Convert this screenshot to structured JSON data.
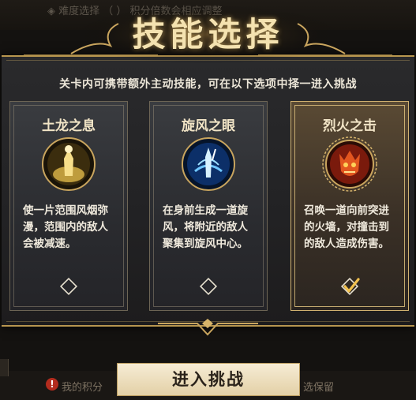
{
  "background": {
    "top_text": "◈ 难度选择 （  ） 积分倍数会相应调整",
    "bottom_left": "我的积分",
    "bottom_right": "选保留",
    "warn_glyph": "!"
  },
  "dialog": {
    "title": "技能选择",
    "subtitle": "关卡内可携带额外主动技能，可在以下选项中择一进入挑战",
    "colors": {
      "gold": "#b8964f",
      "selected_accent": "#d2b271"
    }
  },
  "cards": [
    {
      "name": "土龙之息",
      "icon": "earth-dragon-icon",
      "description": "使一片范围风烟弥漫，范围内的敌人会被减速。",
      "selected": false
    },
    {
      "name": "旋风之眼",
      "icon": "whirlwind-icon",
      "description": "在身前生成一道旋风，将附近的敌人聚集到旋风中心。",
      "selected": false
    },
    {
      "name": "烈火之击",
      "icon": "fire-demon-icon",
      "description": "召唤一道向前突进的火墙，对撞击到的敌人造成伤害。",
      "selected": true
    }
  ],
  "actions": {
    "enter_label": "进入挑战"
  }
}
